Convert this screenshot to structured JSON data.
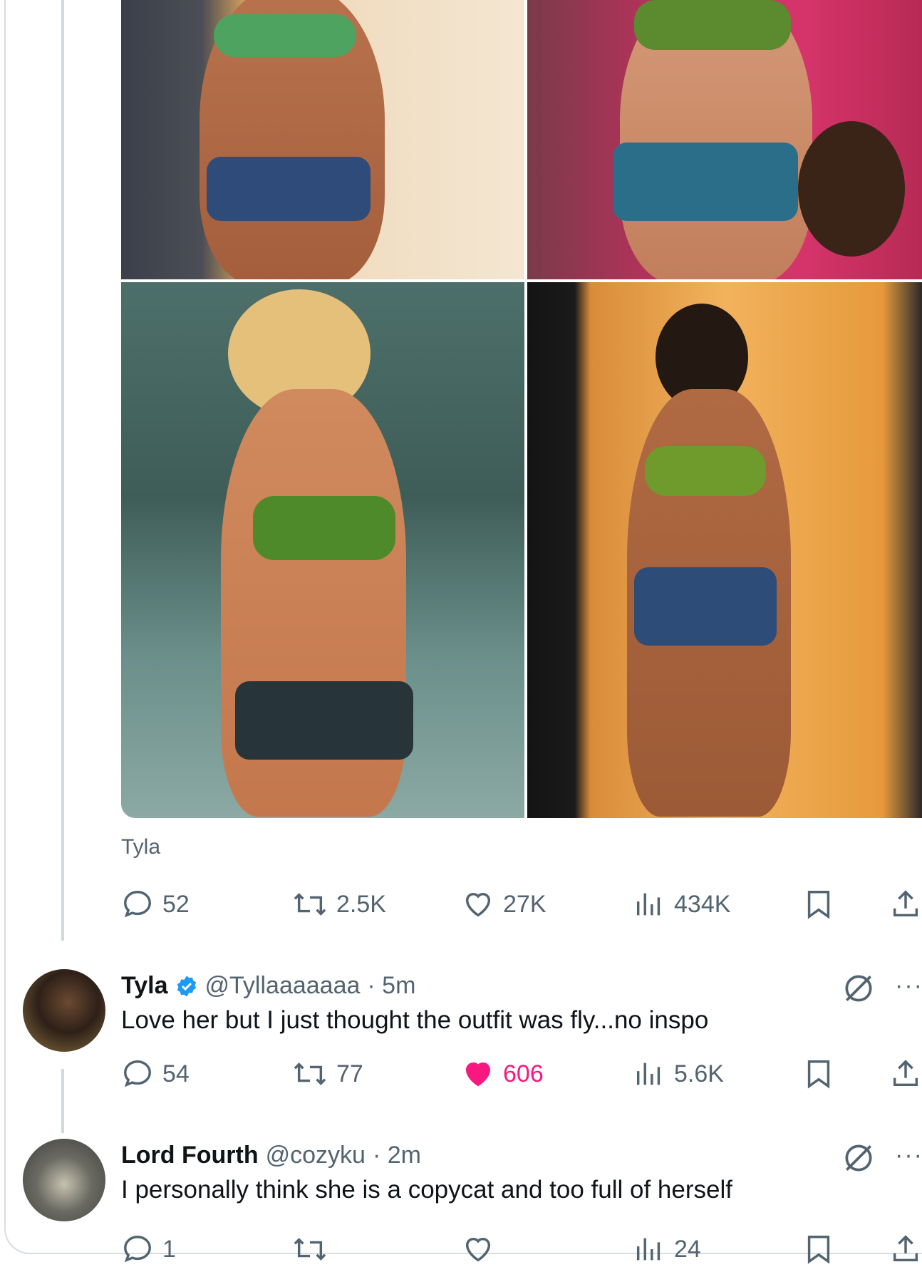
{
  "post": {
    "caption": "Tyla",
    "stats": {
      "replies": "52",
      "reposts": "2.5K",
      "likes": "27K",
      "views": "434K"
    }
  },
  "replies": [
    {
      "name": "Tyla",
      "verified": true,
      "handle": "@Tyllaaaaaaa",
      "time": "· 5m",
      "text": "Love her but I just thought the outfit was fly...no inspo",
      "stats": {
        "replies": "54",
        "reposts": "77",
        "likes": "606",
        "views": "5.6K"
      },
      "liked": true
    },
    {
      "name": "Lord Fourth",
      "verified": false,
      "handle": "@cozyku",
      "time": "· 2m",
      "text": "I personally think she is a copycat and too full of herself",
      "stats": {
        "replies": "1",
        "reposts": "",
        "likes": "",
        "views": "24"
      },
      "liked": false
    }
  ],
  "colors": {
    "accent": "#1d9bf0",
    "like": "#f91880",
    "muted": "#536471"
  },
  "icons": [
    "reply-icon",
    "repost-icon",
    "like-icon",
    "views-icon",
    "bookmark-icon",
    "share-icon",
    "grok-icon",
    "more-icon",
    "verified-badge-icon"
  ]
}
